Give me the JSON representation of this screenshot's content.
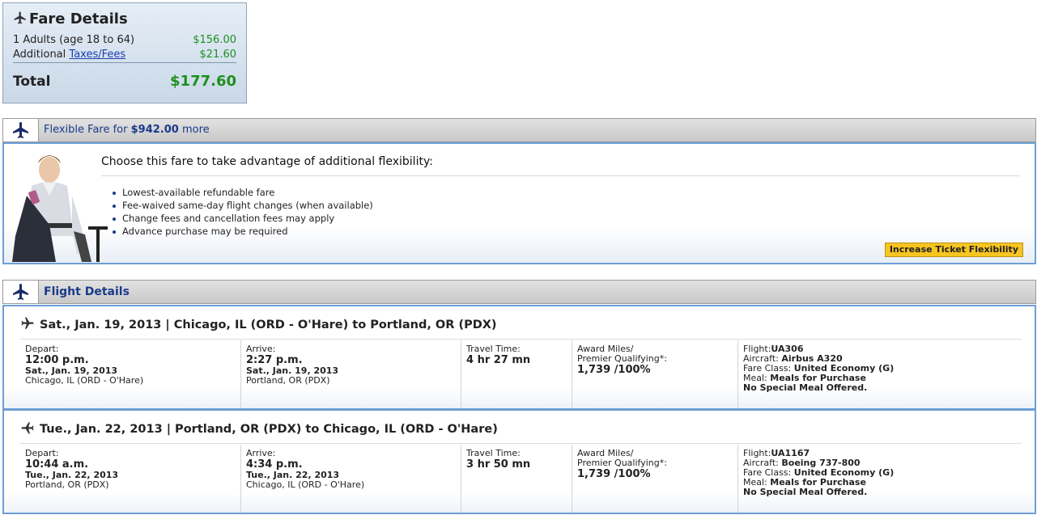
{
  "fare": {
    "title": "Fare Details",
    "adults_label": "1 Adults (age 18 to 64)",
    "adults_amount": "$156.00",
    "additional_label": "Additional",
    "taxes_link": "Taxes/Fees",
    "taxes_amount": "$21.60",
    "total_label": "Total",
    "total_amount": "$177.60"
  },
  "flexible": {
    "prefix": "Flexible Fare for",
    "amount": "$942.00",
    "suffix": "more",
    "heading": "Choose this fare to take advantage of additional flexibility:",
    "bullets": [
      "Lowest-available refundable fare",
      "Fee-waived same-day flight changes (when available)",
      "Change fees and cancellation fees may apply",
      "Advance purchase may be required"
    ],
    "button": "Increase Ticket Flexibility"
  },
  "flight_details": {
    "title": "Flight Details",
    "segments": [
      {
        "heading": "Sat., Jan. 19, 2013 | Chicago, IL (ORD - O'Hare) to Portland, OR (PDX)",
        "depart_label": "Depart:",
        "depart_time": "12:00 p.m.",
        "depart_date": "Sat., Jan. 19, 2013",
        "depart_place": "Chicago, IL (ORD - O'Hare)",
        "arrive_label": "Arrive:",
        "arrive_time": "2:27 p.m.",
        "arrive_date": "Sat., Jan. 19, 2013",
        "arrive_place": "Portland, OR (PDX)",
        "travel_label": "Travel Time:",
        "travel_time": "4 hr 27 mn",
        "miles_label1": "Award Miles/",
        "miles_label2": "Premier Qualifying*:",
        "miles_value": "1,739 /100%",
        "flight_label": "Flight:",
        "flight_no": "UA306",
        "aircraft_label": "Aircraft:",
        "aircraft": "Airbus A320",
        "class_label": "Fare Class:",
        "fare_class": "United Economy (G)",
        "meal_label": "Meal:",
        "meal": "Meals for Purchase",
        "special_meal": "No Special Meal Offered."
      },
      {
        "heading": "Tue., Jan. 22, 2013 | Portland, OR (PDX) to Chicago, IL (ORD - O'Hare)",
        "depart_label": "Depart:",
        "depart_time": "10:44 a.m.",
        "depart_date": "Tue., Jan. 22, 2013",
        "depart_place": "Portland, OR (PDX)",
        "arrive_label": "Arrive:",
        "arrive_time": "4:34 p.m.",
        "arrive_date": "Tue., Jan. 22, 2013",
        "arrive_place": "Chicago, IL (ORD - O'Hare)",
        "travel_label": "Travel Time:",
        "travel_time": "3 hr 50 mn",
        "miles_label1": "Award Miles/",
        "miles_label2": "Premier Qualifying*:",
        "miles_value": "1,739 /100%",
        "flight_label": "Flight:",
        "flight_no": "UA1167",
        "aircraft_label": "Aircraft:",
        "aircraft": "Boeing 737-800",
        "class_label": "Fare Class:",
        "fare_class": "United Economy (G)",
        "meal_label": "Meal:",
        "meal": "Meals for Purchase",
        "special_meal": "No Special Meal Offered."
      }
    ]
  },
  "colors": {
    "accent_blue": "#1a3a8a",
    "price_green": "#1f8f1f",
    "panel_border": "#6d9fd6",
    "button_yellow": "#f8c520"
  },
  "icons": [
    "airplane-icon",
    "traveler-photo"
  ]
}
